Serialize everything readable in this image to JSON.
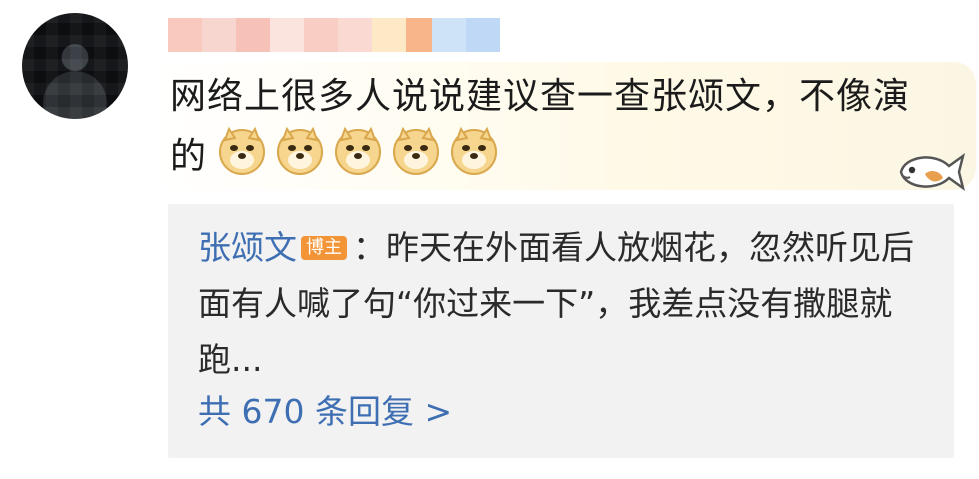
{
  "comment": {
    "text": "网络上很多人说说建议查一查张颂文，不像演的",
    "emoji_icons": [
      "doge-icon",
      "doge-icon",
      "doge-icon",
      "doge-icon",
      "doge-icon"
    ]
  },
  "quote": {
    "author": "张颂文",
    "badge": "博主",
    "separator": "：",
    "text": "昨天在外面看人放烟花，忽然听见后面有人喊了句“你过来一下”，我差点没有撒腿就跑..."
  },
  "replies": {
    "label": "共 670 条回复 >"
  },
  "colors": {
    "link": "#3f6fb3",
    "badge": "#f39536",
    "quote_bg": "#f2f2f3"
  }
}
